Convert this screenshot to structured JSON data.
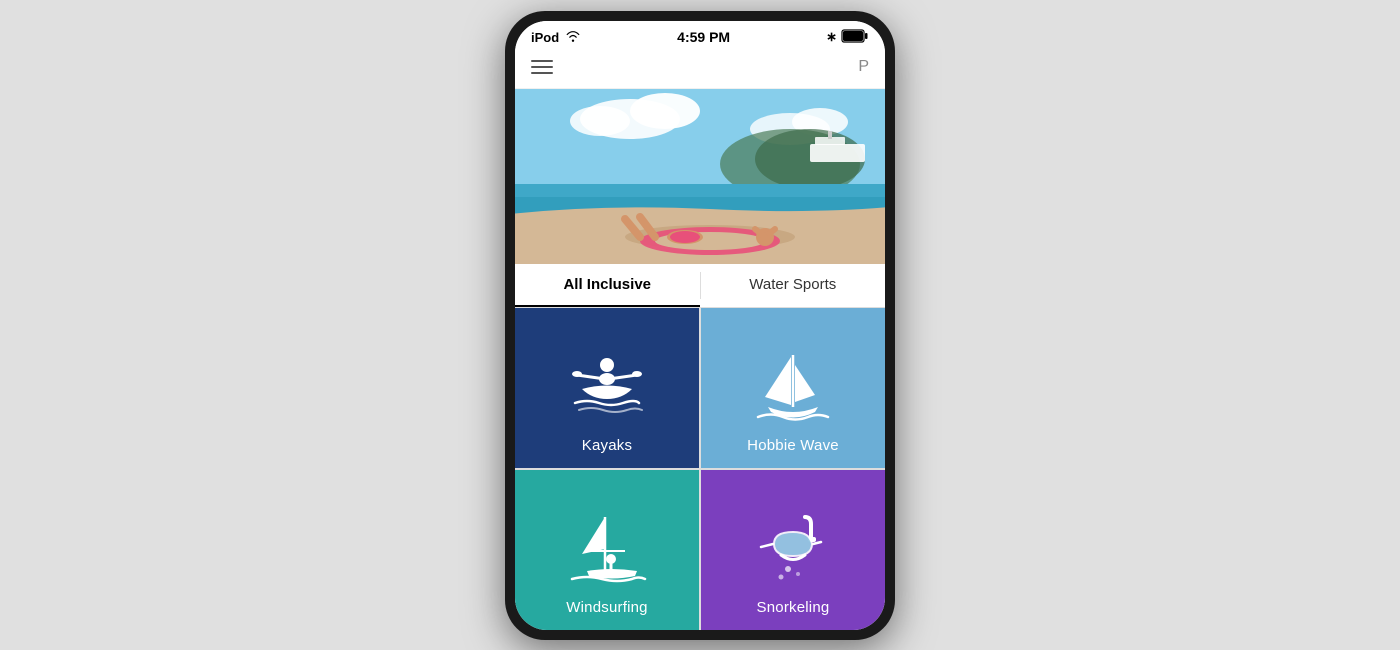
{
  "statusBar": {
    "device": "iPod",
    "wifi": "wifi",
    "time": "4:59 PM",
    "bluetooth": "bluetooth",
    "battery": "battery"
  },
  "navBar": {
    "menuIcon": "menu",
    "profileIcon": "P"
  },
  "hero": {
    "altText": "Beach scene with person relaxing on pink inflatable ring"
  },
  "tabs": [
    {
      "id": "all-inclusive",
      "label": "All Inclusive",
      "active": true
    },
    {
      "id": "water-sports",
      "label": "Water Sports",
      "active": false
    }
  ],
  "activityCards": [
    {
      "id": "kayaks",
      "label": "Kayaks",
      "icon": "kayak",
      "colorClass": "card-kayak"
    },
    {
      "id": "hobbie-wave",
      "label": "Hobbie Wave",
      "icon": "sailing",
      "colorClass": "card-sailing"
    },
    {
      "id": "windsurfing",
      "label": "Windsurfing",
      "icon": "windsurf",
      "colorClass": "card-windsurfing"
    },
    {
      "id": "snorkeling",
      "label": "Snorkeling",
      "icon": "snorkel",
      "colorClass": "card-snorkel"
    }
  ]
}
